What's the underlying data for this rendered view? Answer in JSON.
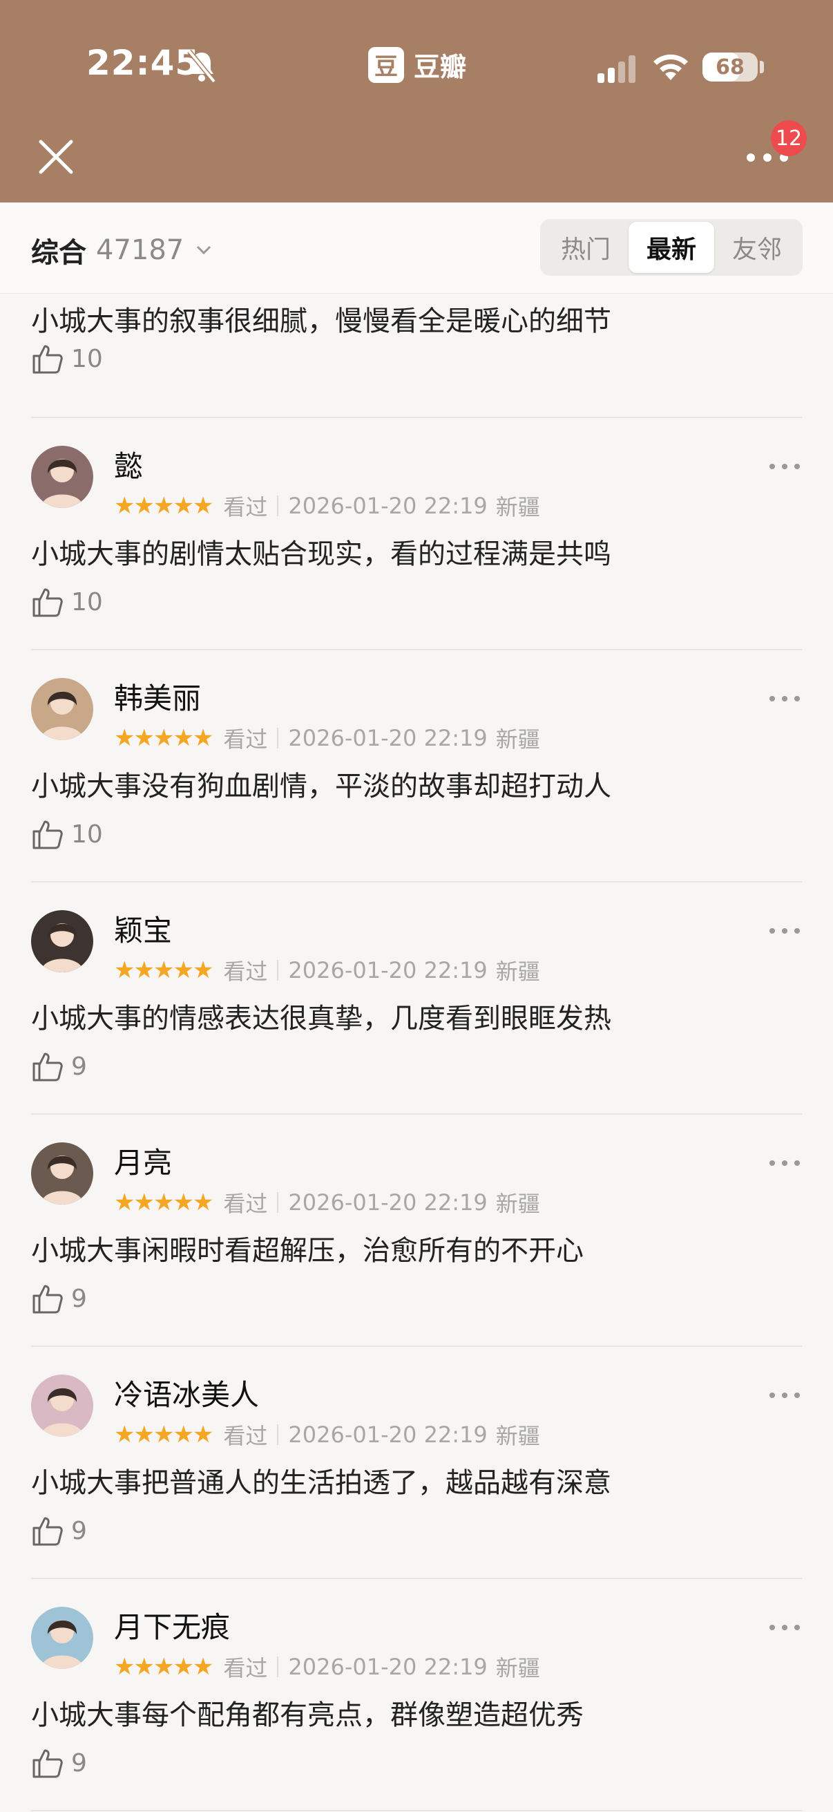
{
  "status_bar": {
    "time": "22:45",
    "app_name": "豆瓣",
    "app_logo_char": "豆",
    "battery": "68",
    "battery_level": 0.68
  },
  "header": {
    "notification_count": "12"
  },
  "filter": {
    "sort_label": "综合",
    "count": "47187",
    "tabs": [
      "热门",
      "最新",
      "友邻"
    ],
    "active_tab": "最新"
  },
  "partial_review": {
    "content": "小城大事的叙事很细腻，慢慢看全是暖心的细节",
    "likes": "10"
  },
  "reviews": [
    {
      "name": "懿",
      "stars": "★★★★★",
      "status": "看过",
      "datetime": "2026-01-20 22:19",
      "location": "新疆",
      "content": "小城大事的剧情太贴合现实，看的过程满是共鸣",
      "likes": "10",
      "avatar_color": "#8a6d6a"
    },
    {
      "name": "韩美丽",
      "stars": "★★★★★",
      "status": "看过",
      "datetime": "2026-01-20 22:19",
      "location": "新疆",
      "content": "小城大事没有狗血剧情，平淡的故事却超打动人",
      "likes": "10",
      "avatar_color": "#c9a88a"
    },
    {
      "name": "颖宝",
      "stars": "★★★★★",
      "status": "看过",
      "datetime": "2026-01-20 22:19",
      "location": "新疆",
      "content": "小城大事的情感表达很真挚，几度看到眼眶发热",
      "likes": "9",
      "avatar_color": "#3d3431"
    },
    {
      "name": "月亮",
      "stars": "★★★★★",
      "status": "看过",
      "datetime": "2026-01-20 22:19",
      "location": "新疆",
      "content": "小城大事闲暇时看超解压，治愈所有的不开心",
      "likes": "9",
      "avatar_color": "#6b5a50"
    },
    {
      "name": "冷语冰美人",
      "stars": "★★★★★",
      "status": "看过",
      "datetime": "2026-01-20 22:19",
      "location": "新疆",
      "content": "小城大事把普通人的生活拍透了，越品越有深意",
      "likes": "9",
      "avatar_color": "#d8b9c4"
    },
    {
      "name": "月下无痕",
      "stars": "★★★★★",
      "status": "看过",
      "datetime": "2026-01-20 22:19",
      "location": "新疆",
      "content": "小城大事每个配角都有亮点，群像塑造超优秀",
      "likes": "9",
      "avatar_color": "#9fc3d6"
    }
  ],
  "colors": {
    "header_bg": "#a77f64",
    "star": "#f5a623",
    "badge": "#ee4b4f"
  }
}
